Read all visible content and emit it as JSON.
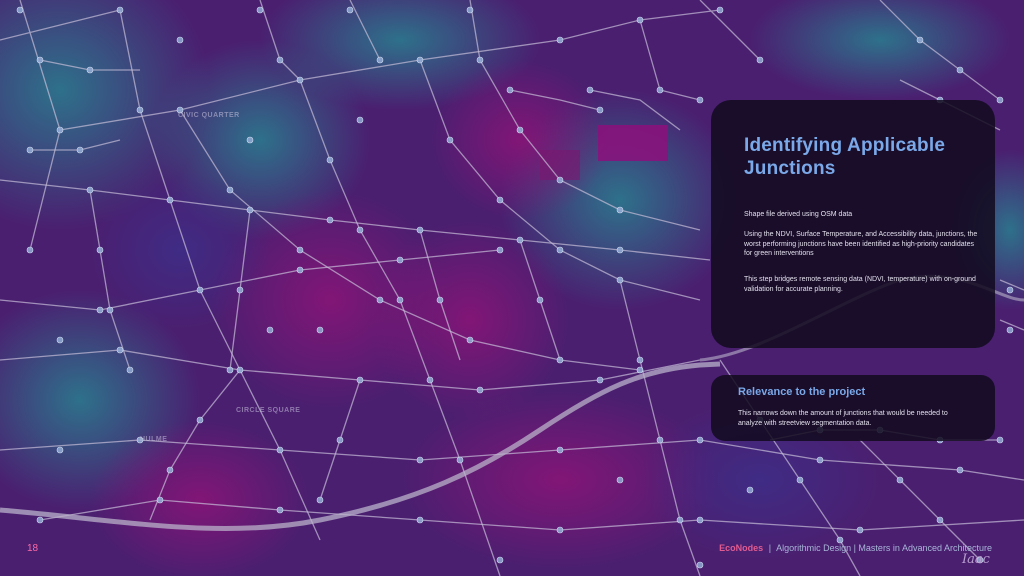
{
  "slide": {
    "page_number": "18",
    "title": "Identifying Applicable Junctions",
    "paragraphs": [
      "Shape file derived using OSM data",
      "Using the NDVI, Surface Temperature, and Accessibility data, junctions, the worst performing junctions have been identified as high-priority candidates for green interventions",
      "This step bridges remote sensing data (NDVI, temperature) with on-ground validation for accurate planning."
    ],
    "relevance": {
      "heading": "Relevance to the project",
      "text": "This narrows down the amount of junctions that would be needed to analyze with streetview segmentation data."
    },
    "footer": {
      "brand": "EcoNodes",
      "separator": "|",
      "rest": "Algorithmic Design | Masters in Advanced Architecture"
    },
    "corner_logo": "Iaac"
  },
  "map": {
    "place_labels": [
      "CIVIC QUARTER",
      "CIRCLE SQUARE",
      "HULME"
    ],
    "colors": {
      "heat_purple": "#5b1b7a",
      "heat_magenta": "#8a1473",
      "heat_teal": "#2a6f8c",
      "road": "#c7bfd8",
      "node": "#8fa9d4",
      "motorway": "#b9b2c9"
    }
  }
}
